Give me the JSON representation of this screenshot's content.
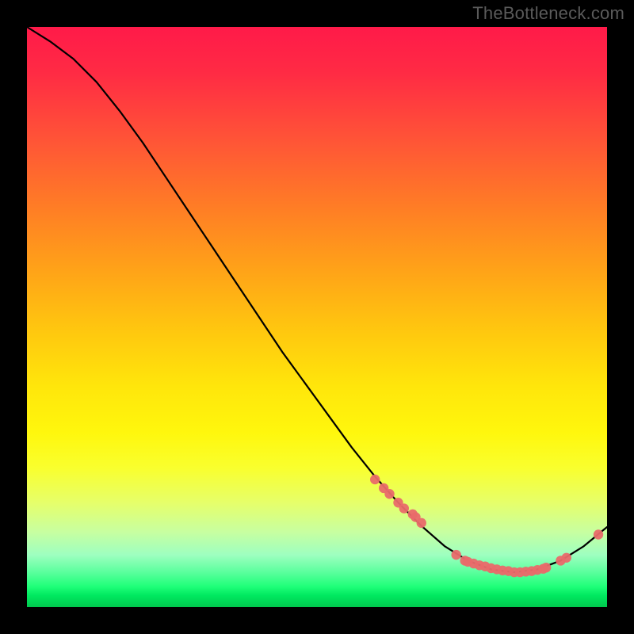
{
  "watermark": "TheBottleneck.com",
  "chart_data": {
    "type": "line",
    "title": "",
    "xlabel": "",
    "ylabel": "",
    "xlim": [
      0,
      100
    ],
    "ylim": [
      0,
      100
    ],
    "grid": false,
    "legend": false,
    "series": [
      {
        "name": "curve",
        "style": "line",
        "color": "#000000",
        "x": [
          0,
          4,
          8,
          12,
          16,
          20,
          24,
          28,
          32,
          36,
          40,
          44,
          48,
          52,
          56,
          60,
          64,
          68,
          72,
          76,
          80,
          84,
          88,
          92,
          96,
          100
        ],
        "y": [
          100,
          97.5,
          94.5,
          90.5,
          85.5,
          80,
          74,
          68,
          62,
          56,
          50,
          44,
          38.5,
          33,
          27.5,
          22.5,
          18,
          14,
          10.5,
          8,
          6.5,
          6,
          6.5,
          8,
          10.5,
          13.8
        ]
      },
      {
        "name": "markers",
        "style": "scatter",
        "color": "#e96a6a",
        "x": [
          60,
          61.5,
          62.5,
          64,
          65,
          66.5,
          67,
          68,
          74,
          75.5,
          76,
          77,
          78,
          79,
          80,
          81,
          82,
          83,
          84,
          85,
          86,
          87,
          88,
          89,
          89.5,
          92,
          93,
          98.5
        ],
        "y": [
          22,
          20.5,
          19.5,
          18,
          17,
          16,
          15.5,
          14.5,
          9,
          8,
          7.8,
          7.5,
          7.2,
          7,
          6.7,
          6.5,
          6.3,
          6.2,
          6,
          6,
          6.1,
          6.2,
          6.4,
          6.6,
          6.8,
          8,
          8.5,
          12.5
        ]
      }
    ],
    "background_gradient": {
      "orientation": "vertical",
      "stops": [
        {
          "pos": 0,
          "color": "#ff1a49"
        },
        {
          "pos": 50,
          "color": "#ffd010"
        },
        {
          "pos": 78,
          "color": "#f2ff40"
        },
        {
          "pos": 100,
          "color": "#00c94e"
        }
      ]
    }
  }
}
